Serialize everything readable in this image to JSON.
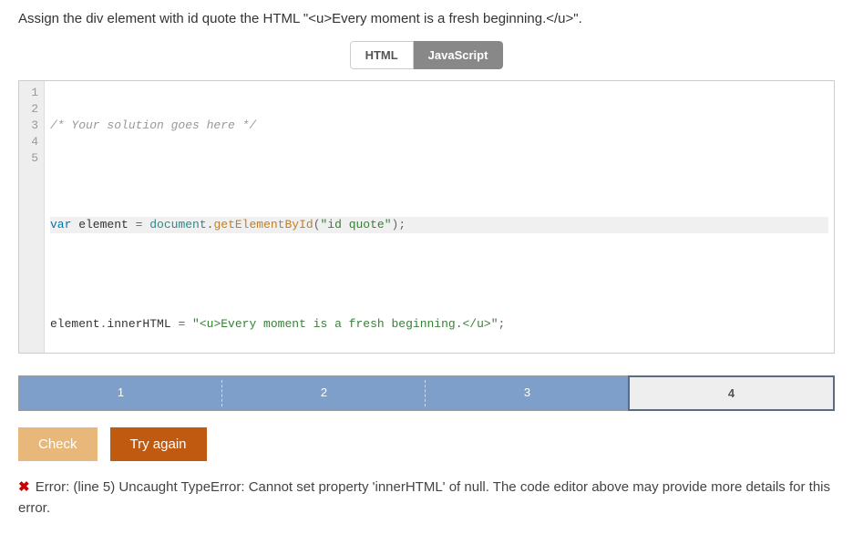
{
  "instruction": "Assign the div element with id quote the HTML \"<u>Every moment is a fresh beginning.</u>\".",
  "tabs": {
    "html": "HTML",
    "js": "JavaScript"
  },
  "code": {
    "line1": "/* Your solution goes here */",
    "line3_var": "var",
    "line3_element": " element ",
    "line3_eq": "= ",
    "line3_doc": "document",
    "line3_dot": ".",
    "line3_method": "getElementById",
    "line3_open": "(",
    "line3_str": "\"id quote\"",
    "line3_close": ");",
    "line5_obj": "element",
    "line5_dot": ".",
    "line5_prop": "innerHTML ",
    "line5_eq": "= ",
    "line5_str": "\"<u>Every moment is a fresh beginning.</u>\"",
    "line5_semi": ";"
  },
  "gutter": [
    "1",
    "2",
    "3",
    "4",
    "5"
  ],
  "steps": [
    "1",
    "2",
    "3",
    "4"
  ],
  "buttons": {
    "check": "Check",
    "retry": "Try again"
  },
  "error": {
    "prefix": "✖",
    "text": " Error: (line 5) Uncaught TypeError: Cannot set property 'innerHTML' of null. The code editor above may provide more details for this error."
  }
}
